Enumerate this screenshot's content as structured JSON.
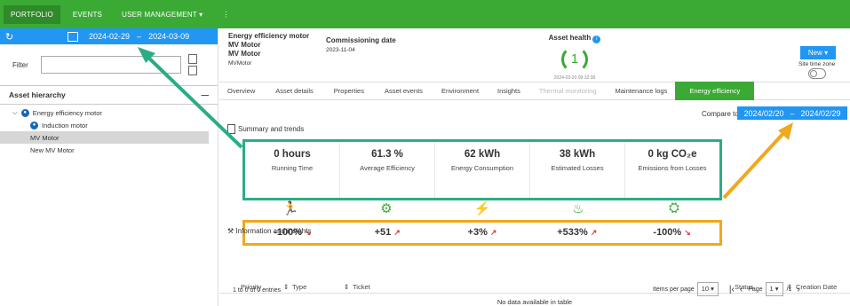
{
  "nav": {
    "items": [
      "PORTFOLIO",
      "EVENTS",
      "USER MANAGEMENT ▾",
      "⋮"
    ]
  },
  "left": {
    "date_from": "2024-02-29",
    "date_sep": "–",
    "date_to": "2024-03-09",
    "filter_label": "Filter",
    "hierarchy_title": "Asset hierarchy",
    "tree": [
      {
        "label": "Energy efficiency motor"
      },
      {
        "label": "Induction motor"
      },
      {
        "label": "MV Motor"
      },
      {
        "label": "New MV Motor"
      }
    ]
  },
  "asset": {
    "title": "Energy efficiency motor",
    "name1": "MV Motor",
    "name2": "MV Motor",
    "name3": "MVMotor",
    "comm_label": "Commissioning date",
    "comm_date": "2023-11-04",
    "health_label": "Asset health",
    "health_value": "1",
    "health_time": "2024-03-20 09:32:38"
  },
  "actions": {
    "new": "New ▾",
    "toggle_label": "Site time zone"
  },
  "tabs": [
    "Overview",
    "Asset details",
    "Properties",
    "Asset events",
    "Environment",
    "Insights",
    "Thermal monitoring",
    "Maintenance logs",
    "Energy efficiency"
  ],
  "compare": {
    "label": "Compare to :",
    "from": "2024/02/20",
    "sep": "–",
    "to": "2024/02/29"
  },
  "summary_title": "Summary and trends",
  "kpis": [
    {
      "value": "0 hours",
      "label": "Running Time"
    },
    {
      "value": "61.3 %",
      "label": "Average Efficiency"
    },
    {
      "value": "62 kWh",
      "label": "Energy Consumption"
    },
    {
      "value": "38 kWh",
      "label": "Estimated Losses"
    },
    {
      "value": "0 kg CO₂e",
      "label": "Emissions from Losses"
    }
  ],
  "deltas": [
    {
      "value": "-100%",
      "arrow": "↘"
    },
    {
      "value": "+51",
      "arrow": "↗"
    },
    {
      "value": "+3%",
      "arrow": "↗"
    },
    {
      "value": "+533%",
      "arrow": "↗"
    },
    {
      "value": "-100%",
      "arrow": "↘"
    }
  ],
  "icons": [
    "running-person-icon",
    "gear-icon",
    "lightning-icon",
    "flame-icon",
    "factory-icon"
  ],
  "info_title": "Information and insights",
  "table": {
    "cols": [
      "Priority",
      "Type",
      "Ticket",
      "Status",
      "Creation Date"
    ],
    "empty": "No data available in table"
  },
  "footer": {
    "entries": "1 to 0 of 0 entries",
    "per_page_label": "Items per page",
    "per_page": "10",
    "page_label": "Page",
    "page": "1",
    "of": "/1"
  },
  "colors": {
    "green": "#3aaa35",
    "blue": "#2196f3",
    "teal": "#2bac87",
    "orange": "#f0a81d"
  }
}
